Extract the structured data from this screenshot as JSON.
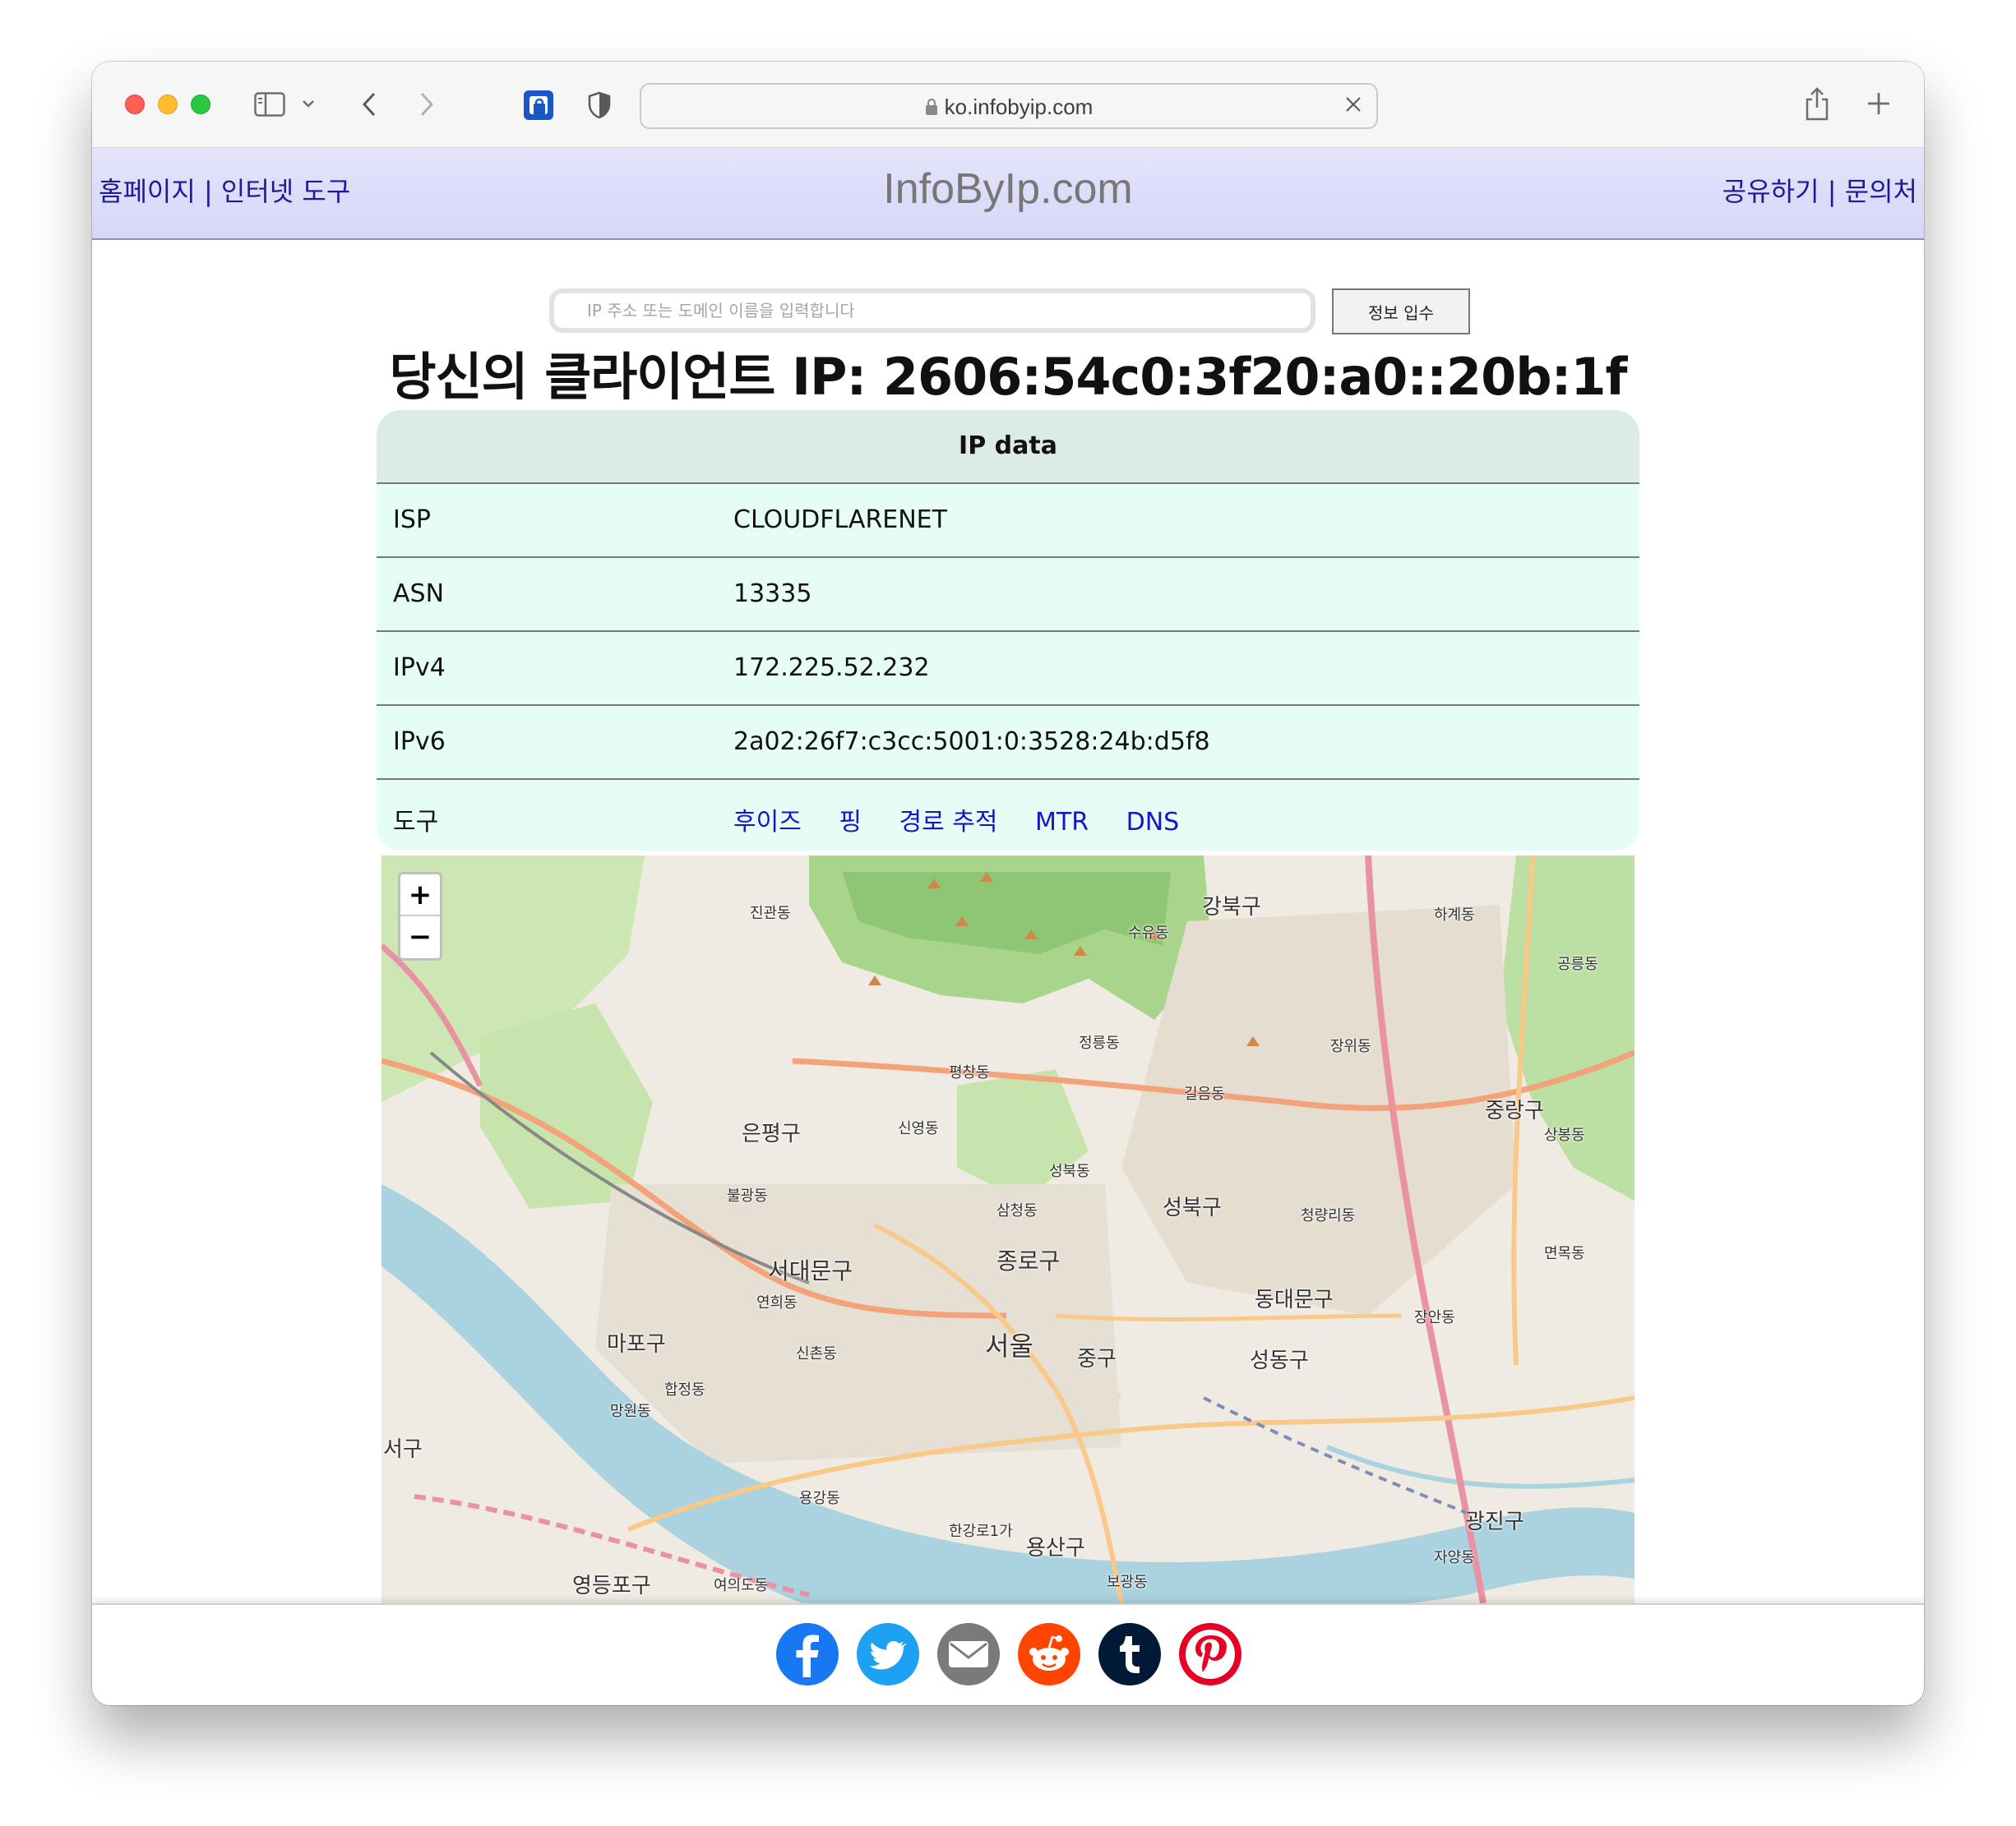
{
  "browser": {
    "url": "ko.infobyip.com"
  },
  "header": {
    "home": "홈페이지",
    "tools": "인터넷 도구",
    "separator": "|",
    "title": "InfoByIp.com",
    "share": "공유하기",
    "contact": "문의처"
  },
  "search": {
    "placeholder": "IP 주소 또는 도메인 이름을 입력합니다",
    "button": "정보 입수"
  },
  "heading": "당신의 클라이언트 IP: 2606:54c0:3f20:a0::20b:1f",
  "ip_table": {
    "title": "IP data",
    "rows": [
      {
        "key": "ISP",
        "value": "CLOUDFLARENET"
      },
      {
        "key": "ASN",
        "value": "13335"
      },
      {
        "key": "IPv4",
        "value": "172.225.52.232"
      },
      {
        "key": "IPv6",
        "value": "2a02:26f7:c3cc:5001:0:3528:24b:d5f8"
      }
    ],
    "tools_label": "도구",
    "tools": [
      "후이즈",
      "핑",
      "경로 추적",
      "MTR",
      "DNS"
    ]
  },
  "map": {
    "zoom_in": "+",
    "zoom_out": "−",
    "labels": [
      {
        "text": "강북구",
        "size": 26
      },
      {
        "text": "은평구",
        "size": 26
      },
      {
        "text": "성북구",
        "size": 26
      },
      {
        "text": "종로구",
        "size": 28
      },
      {
        "text": "서대문구",
        "size": 28
      },
      {
        "text": "동대문구",
        "size": 26
      },
      {
        "text": "중랑구",
        "size": 26
      },
      {
        "text": "마포구",
        "size": 26
      },
      {
        "text": "서울",
        "size": 32
      },
      {
        "text": "중구",
        "size": 26
      },
      {
        "text": "성동구",
        "size": 26
      },
      {
        "text": "용산구",
        "size": 26
      },
      {
        "text": "광진구",
        "size": 26
      },
      {
        "text": "영등포구",
        "size": 26
      },
      {
        "text": "서구",
        "size": 26
      },
      {
        "text": "진관동",
        "size": 18
      },
      {
        "text": "수유동",
        "size": 18
      },
      {
        "text": "하계동",
        "size": 18
      },
      {
        "text": "정릉동",
        "size": 18
      },
      {
        "text": "평창동",
        "size": 18
      },
      {
        "text": "불광동",
        "size": 18
      },
      {
        "text": "신영동",
        "size": 18
      },
      {
        "text": "삼청동",
        "size": 18
      },
      {
        "text": "성북동",
        "size": 18
      },
      {
        "text": "길음동",
        "size": 18
      },
      {
        "text": "장위동",
        "size": 18
      },
      {
        "text": "청량리동",
        "size": 18
      },
      {
        "text": "연희동",
        "size": 18
      },
      {
        "text": "신촌동",
        "size": 18
      },
      {
        "text": "망원동",
        "size": 18
      },
      {
        "text": "합정동",
        "size": 18
      },
      {
        "text": "용강동",
        "size": 18
      },
      {
        "text": "한강로1가",
        "size": 18
      },
      {
        "text": "보광동",
        "size": 18
      },
      {
        "text": "자양동",
        "size": 18
      },
      {
        "text": "여의도동",
        "size": 18
      },
      {
        "text": "면목동",
        "size": 18
      },
      {
        "text": "장안동",
        "size": 18
      },
      {
        "text": "상봉동",
        "size": 18
      },
      {
        "text": "공릉동",
        "size": 18
      }
    ]
  },
  "share": {
    "icons": [
      "facebook-icon",
      "twitter-icon",
      "email-icon",
      "reddit-icon",
      "tumblr-icon",
      "pinterest-icon"
    ],
    "colors": {
      "facebook": "#1877f2",
      "twitter": "#1da1f2",
      "email": "#7a7a7a",
      "reddit": "#ff4500",
      "tumblr": "#001935",
      "pinterest": "#e60023"
    }
  }
}
